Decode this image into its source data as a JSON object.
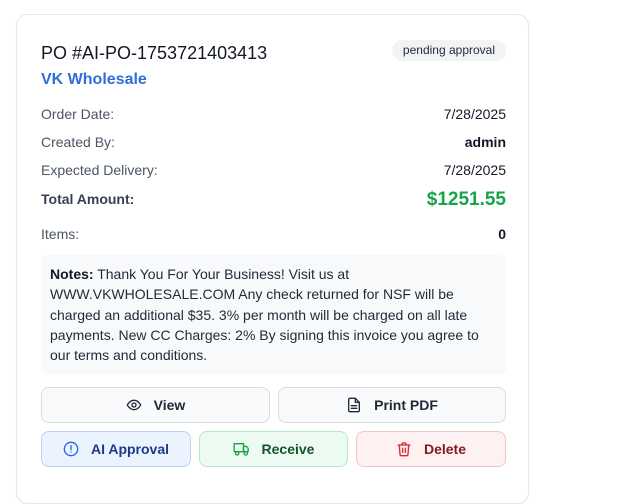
{
  "po": {
    "number": "PO #AI-PO-1753721403413",
    "status": "pending approval",
    "vendor": "VK Wholesale"
  },
  "details": {
    "order_date_label": "Order Date:",
    "order_date": "7/28/2025",
    "created_by_label": "Created By:",
    "created_by": "admin",
    "expected_delivery_label": "Expected Delivery:",
    "expected_delivery": "7/28/2025",
    "total_label": "Total Amount:",
    "total": "$1251.55",
    "items_label": "Items:",
    "items": "0"
  },
  "notes": {
    "label": "Notes:",
    "text": " Thank You For Your Business! Visit us at WWW.VKWHOLESALE.COM Any check returned for NSF will be charged an additional $35. 3% per month will be charged on all late payments. New CC Charges: 2% By signing this invoice you agree to our terms and conditions."
  },
  "actions": {
    "view": "View",
    "print_pdf": "Print PDF",
    "ai_approval": "AI Approval",
    "receive": "Receive",
    "delete": "Delete"
  },
  "icons": {
    "view": "eye-icon",
    "print_pdf": "file-text-icon",
    "ai_approval": "alert-circle-icon",
    "receive": "truck-icon",
    "delete": "trash-icon"
  },
  "colors": {
    "vendor": "#2f6fd6",
    "total": "#16a34a",
    "ai_approval_icon": "#2563eb",
    "receive_icon": "#16a34a",
    "delete_icon": "#dc2626"
  }
}
